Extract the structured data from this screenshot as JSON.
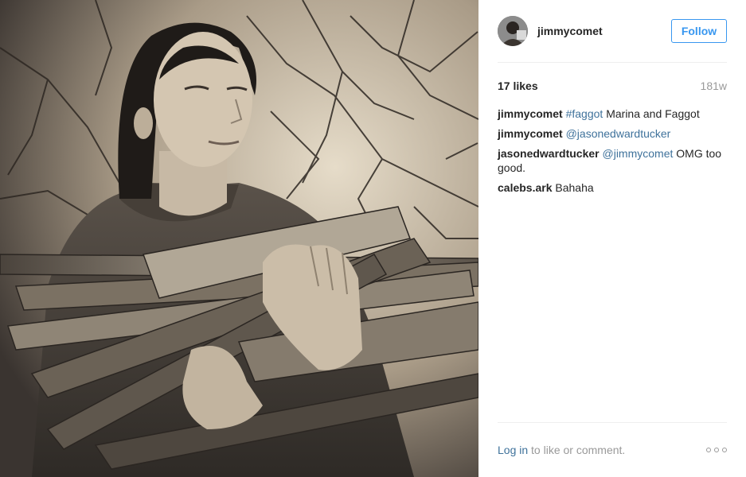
{
  "post": {
    "photo_alt": "Marina Abramović holding an armful of firewood branches",
    "author": {
      "username": "jimmycomet",
      "avatar_icon": "user-avatar"
    },
    "follow_label": "Follow",
    "likes": "17 likes",
    "time_ago": "181w",
    "comments": [
      {
        "author": "jimmycomet",
        "link": "#faggot",
        "text": " Marina and Faggot"
      },
      {
        "author": "jimmycomet",
        "link": "@jasonedwardtucker",
        "text": ""
      },
      {
        "author": "jasonedwardtucker",
        "link": "@jimmycomet",
        "text": " OMG too good."
      },
      {
        "author": "calebs.ark",
        "link": "",
        "text": "Bahaha"
      }
    ],
    "footer": {
      "login_link": "Log in",
      "login_suffix": " to like or comment.",
      "more_icon": "ellipsis-icon"
    }
  },
  "colors": {
    "accent": "#3897f0",
    "link": "#3f729b",
    "muted": "#999999",
    "text": "#262626",
    "divider": "#efefef"
  }
}
